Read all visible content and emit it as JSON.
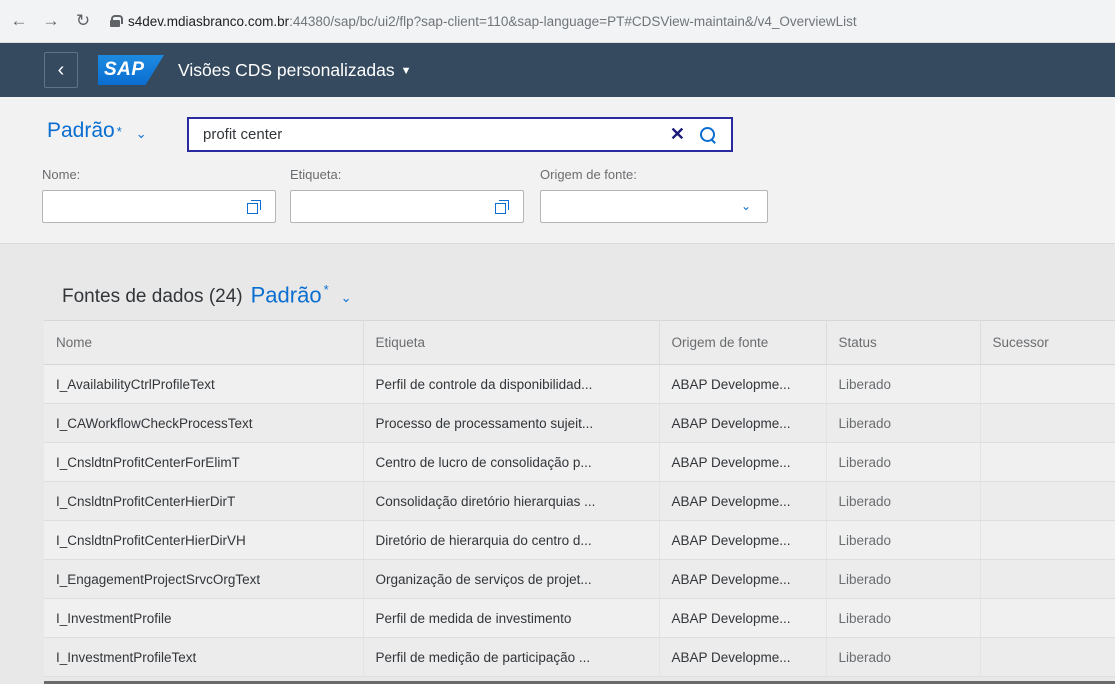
{
  "browser": {
    "url_host": "s4dev.mdiasbranco.com.br",
    "url_rest": ":44380/sap/bc/ui2/flp?sap-client=110&sap-language=PT#CDSView-maintain&/v4_OverviewList"
  },
  "shell": {
    "logo": "SAP",
    "app_title": "Visões CDS personalizadas"
  },
  "filter": {
    "variant": "Padrão",
    "search_value": "profit center",
    "fields": [
      {
        "label": "Nome:"
      },
      {
        "label": "Etiqueta:"
      },
      {
        "label": "Origem de fonte:"
      }
    ]
  },
  "table": {
    "title": "Fontes de dados (24)",
    "variant": "Padrão",
    "columns": [
      "Nome",
      "Etiqueta",
      "Origem de fonte",
      "Status",
      "Sucessor"
    ],
    "rows": [
      [
        "I_AvailabilityCtrlProfileText",
        "Perfil de controle da disponibilidad...",
        "ABAP Developme...",
        "Liberado",
        ""
      ],
      [
        "I_CAWorkflowCheckProcessText",
        "Processo de processamento sujeit...",
        "ABAP Developme...",
        "Liberado",
        ""
      ],
      [
        "I_CnsldtnProfitCenterForElimT",
        "Centro de lucro de consolidação p...",
        "ABAP Developme...",
        "Liberado",
        ""
      ],
      [
        "I_CnsldtnProfitCenterHierDirT",
        "Consolidação diretório hierarquias ...",
        "ABAP Developme...",
        "Liberado",
        ""
      ],
      [
        "I_CnsldtnProfitCenterHierDirVH",
        "Diretório de hierarquia do centro d...",
        "ABAP Developme...",
        "Liberado",
        ""
      ],
      [
        "I_EngagementProjectSrvcOrgText",
        "Organização de serviços de projet...",
        "ABAP Developme...",
        "Liberado",
        ""
      ],
      [
        "I_InvestmentProfile",
        "Perfil de medida de investimento",
        "ABAP Developme...",
        "Liberado",
        ""
      ],
      [
        "I_InvestmentProfileText",
        "Perfil de medição de participação ...",
        "ABAP Developme...",
        "Liberado",
        ""
      ]
    ]
  }
}
